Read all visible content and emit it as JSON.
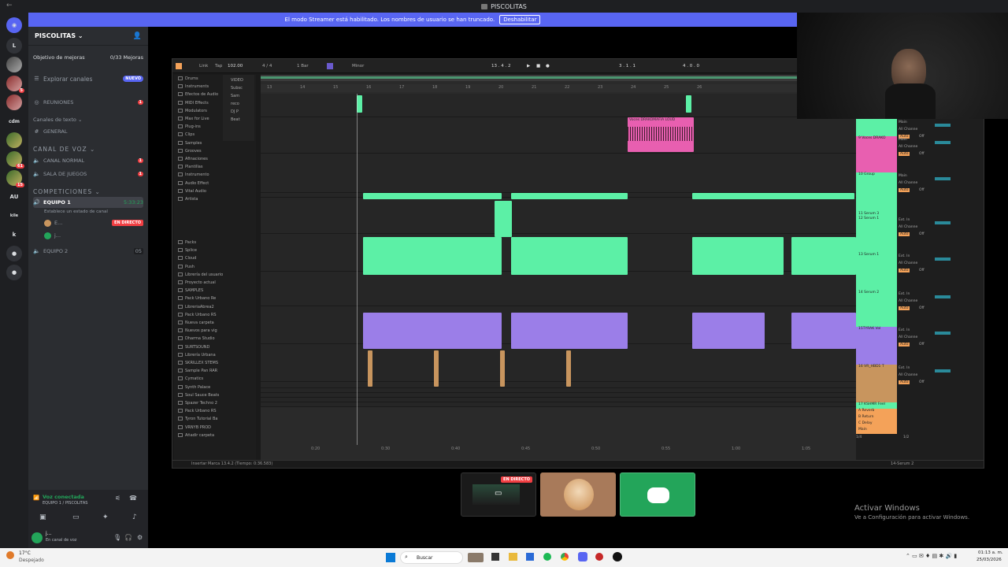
{
  "window": {
    "title": "PISCOLITAS"
  },
  "banner": {
    "text": "El modo Streamer está habilitado. Los nombres de usuario se han truncado.",
    "button": "Deshabilitar"
  },
  "rail": {
    "labels": [
      "L",
      "cdm",
      "AU",
      "kile",
      "k"
    ],
    "badges": [
      "5",
      "61",
      "15"
    ]
  },
  "sidebar": {
    "server_name": "PISCOLITAS",
    "goal_label": "Objetivo de mejoras",
    "goal_value": "0/33 Mejoras",
    "explore": "Explorar canales",
    "new_badge": "NUEVO",
    "meetings": "REUNIONES",
    "meetings_badge": "1",
    "text_category": "Canales de texto",
    "general": "GENERAL",
    "voice_category": "CANAL DE VOZ",
    "voice_channels": [
      {
        "name": "CANAL NORMAL",
        "badge": "1"
      },
      {
        "name": "SALA DE JUEGOS",
        "badge": "1"
      }
    ],
    "comp_category": "COMPETICIONES",
    "equipo1": "EQUIPO 1",
    "equipo1_time": "5:33:23",
    "equipo1_status": "Establece un estado de canal",
    "user1": "E...",
    "live": "EN DIRECTO",
    "user2": "j...",
    "equipo2": "EQUIPO 2",
    "equipo2_count": "05"
  },
  "voice": {
    "status": "Voz conectada",
    "channel": "EQUIPO 1 / PISCOLITAS",
    "user": "j...",
    "user_status": "En canal de voz"
  },
  "tiles": {
    "live": "EN DIRECTO"
  },
  "ableton": {
    "link": "Link",
    "tap": "Tap",
    "bpm": "102.00",
    "meter": "4 / 4",
    "quant": "1 Bar",
    "key": "Minor",
    "position": "13 . 4 . 2",
    "loop_start": "3 . 1 . 1",
    "loop_len": "4 . 0 . 0",
    "browser_collections": [
      "Drums",
      "Instruments",
      "Efectos de Audio",
      "MIDI Effects",
      "Modulators",
      "Max for Live",
      "Plug-ins",
      "Clips",
      "Samples",
      "Grooves",
      "Afinaciones",
      "Plantillas",
      "Instrumento",
      "Audio Effect",
      "Vital Audio",
      "Artista"
    ],
    "browser_places": [
      "Packs",
      "Splice",
      "Cloud",
      "Push",
      "Librería del usuario",
      "Proyecto actual",
      "SAMPLES",
      "Pack Urbano Re",
      "LibreriaAbrea2",
      "Pack Urbano RS",
      "Nueva carpeta",
      "Nuevos para vig",
      "Dharma Studio",
      "SURTSOUND",
      "Librería Urbana",
      "SKRILLEX STEMS",
      "Sample Pan RAR",
      "Cymatics",
      "Synth Palace",
      "Soul Sauce Beats",
      "Spazer Techno 2",
      "Pack Urbano RS",
      "Tyron Tutorial Ba",
      "VRNYB PROD",
      "Añadir carpeta"
    ],
    "browser_folders": [
      "VIDEO",
      "Subsc",
      "Sam",
      "reco",
      "DJ P",
      "Beat"
    ],
    "bar_numbers": [
      "13",
      "14",
      "15",
      "16",
      "17",
      "18",
      "19",
      "20",
      "21",
      "22",
      "23",
      "24",
      "25",
      "26"
    ],
    "time_marks": [
      "0:20",
      "0:30",
      "0:40",
      "0:45",
      "0:50",
      "0:55",
      "1:00",
      "1:05"
    ],
    "clip_name": "Voces DRAKOMAFIA LOUD",
    "tracks": [
      {
        "name": "",
        "color": "#5cf0a6"
      },
      {
        "name": "9 Voces DRAKO",
        "color": "#e85fb0"
      },
      {
        "name": "10 Group",
        "color": "#5cf0a6"
      },
      {
        "name": "11 Serum 3",
        "color": "#5cf0a6"
      },
      {
        "name": "12 Serum 1",
        "color": "#5cf0a6"
      },
      {
        "name": "13 Serum 1",
        "color": "#5cf0a6"
      },
      {
        "name": "14 Serum 2",
        "color": "#5cf0a6"
      },
      {
        "name": "15TYRAK Vol",
        "color": "#9b7ee8"
      },
      {
        "name": "16 VR_HBD1 T",
        "color": "#c8955e"
      },
      {
        "name": "17 KSHMR Feel",
        "color": "#5cf0a6"
      },
      {
        "name": "A Reverb",
        "color": "#f4a259"
      },
      {
        "name": "B Return",
        "color": "#f4a259"
      },
      {
        "name": "C Delay",
        "color": "#f4a259"
      },
      {
        "name": "Main",
        "color": "#f4a259"
      }
    ],
    "mixer_labels": {
      "ext_in": "Ext. In",
      "all_ins": "All Ins",
      "all_channels": "All Channe",
      "auto": "Auto",
      "off": "Off",
      "main": "Main",
      "group": "10-Group",
      "page": "1/4",
      "page2": "1/2"
    },
    "status": "Insertar Marca 13.4.2 (Tiempo: 0:36.583)",
    "status_right": "14-Serum 2"
  },
  "activate": {
    "line1": "Activar Windows",
    "line2": "Ve a Configuración para activar Windows."
  },
  "taskbar": {
    "temp": "17°C",
    "weather": "Despejado",
    "search": "Buscar",
    "time": "01:13 a. m.",
    "date": "25/03/2026"
  }
}
